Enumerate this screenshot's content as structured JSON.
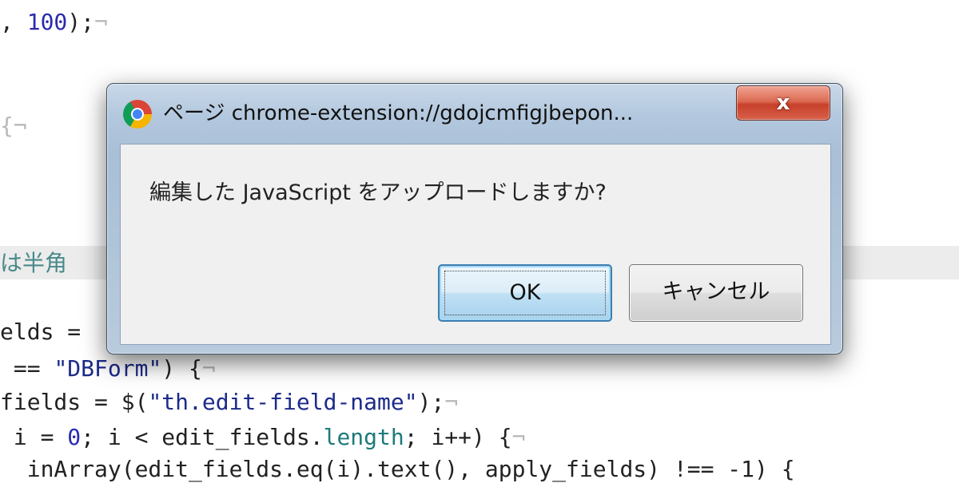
{
  "editor": {
    "lines": [
      [
        {
          "t": ", ",
          "c": ""
        },
        {
          "t": "100",
          "c": "num"
        },
        {
          "t": ");",
          "c": ""
        },
        {
          "t": "¬",
          "c": "mark"
        }
      ],
      [
        {
          "t": "{",
          "c": "mark"
        },
        {
          "t": "¬",
          "c": "mark"
        }
      ],
      [
        {
          "t": "は半角",
          "c": "cmt"
        }
      ],
      [
        {
          "t": "elds = ",
          "c": ""
        }
      ],
      [
        {
          "t": " == ",
          "c": ""
        },
        {
          "t": "\"DBForm\"",
          "c": "str"
        },
        {
          "t": ") {",
          "c": ""
        },
        {
          "t": "¬",
          "c": "mark"
        }
      ],
      [
        {
          "t": "fields = $(",
          "c": ""
        },
        {
          "t": "\"th.edit-field-name\"",
          "c": "str"
        },
        {
          "t": ");",
          "c": ""
        },
        {
          "t": "¬",
          "c": "mark"
        }
      ],
      [
        {
          "t": " i = ",
          "c": ""
        },
        {
          "t": "0",
          "c": "num"
        },
        {
          "t": "; i < edit_fields.",
          "c": ""
        },
        {
          "t": "length",
          "c": "prop"
        },
        {
          "t": "; i++) {",
          "c": ""
        },
        {
          "t": "¬",
          "c": "mark"
        }
      ],
      [
        {
          "t": "  inArray(edit_fields.eq(i).text(), apply_fields) !== -1) {",
          "c": ""
        }
      ]
    ]
  },
  "dialog": {
    "title": "ページ chrome-extension://gdojcmfigjbepon...",
    "close_label": "x",
    "message": "編集した JavaScript をアップロードしますか?",
    "ok_label": "OK",
    "cancel_label": "キャンセル"
  }
}
